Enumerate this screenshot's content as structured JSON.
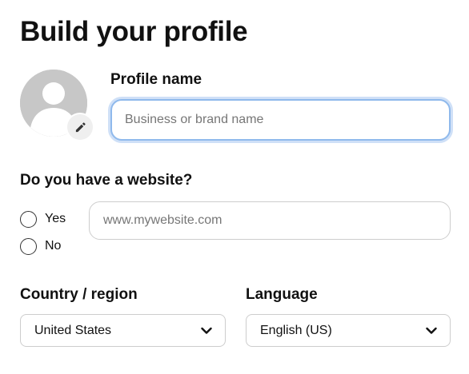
{
  "page": {
    "title": "Build your profile"
  },
  "avatar": {
    "icon": "default-user-avatar",
    "edit_icon": "pencil-icon"
  },
  "profile_name": {
    "label": "Profile name",
    "placeholder": "Business or brand name",
    "value": ""
  },
  "website": {
    "question": "Do you have a website?",
    "options": [
      {
        "label": "Yes",
        "selected": false
      },
      {
        "label": "No",
        "selected": false
      }
    ],
    "placeholder": "www.mywebsite.com",
    "value": ""
  },
  "country": {
    "label": "Country / region",
    "selected": "United States"
  },
  "language": {
    "label": "Language",
    "selected": "English (US)"
  },
  "colors": {
    "focus_border": "#8fb9ec",
    "focus_ring": "#cfe0f7",
    "avatar_bg": "#c7c7c7",
    "input_border": "#cdcdcd"
  }
}
